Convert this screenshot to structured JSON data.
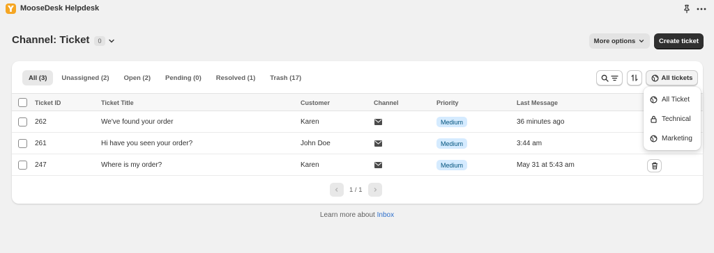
{
  "app": {
    "title": "MooseDesk Helpdesk"
  },
  "header": {
    "title": "Channel: Ticket",
    "count": "0",
    "more_options": "More options",
    "create_ticket": "Create ticket"
  },
  "tabs": [
    {
      "label": "All (3)",
      "active": true
    },
    {
      "label": "Unassigned (2)",
      "active": false
    },
    {
      "label": "Open (2)",
      "active": false
    },
    {
      "label": "Pending (0)",
      "active": false
    },
    {
      "label": "Resolved (1)",
      "active": false
    },
    {
      "label": "Trash (17)",
      "active": false
    }
  ],
  "toolbar": {
    "all_tickets": "All tickets"
  },
  "table": {
    "columns": [
      "Ticket ID",
      "Ticket Title",
      "Customer",
      "Channel",
      "Priority",
      "Last Message"
    ],
    "rows": [
      {
        "id": "262",
        "title": "We've found your order",
        "customer": "Karen",
        "channel": "mail-icon",
        "priority": "Medium",
        "last_message": "36 minutes ago"
      },
      {
        "id": "261",
        "title": "Hi have you seen your order?",
        "customer": "John Doe",
        "channel": "mail-icon",
        "priority": "Medium",
        "last_message": "3:44 am"
      },
      {
        "id": "247",
        "title": "Where is my order?",
        "customer": "Karen",
        "channel": "mail-icon",
        "priority": "Medium",
        "last_message": "May 31 at 5:43 am"
      }
    ]
  },
  "pagination": {
    "text": "1 / 1"
  },
  "dropdown": {
    "items": [
      {
        "label": "All Ticket",
        "icon": "globe-icon"
      },
      {
        "label": "Technical",
        "icon": "lock-icon"
      },
      {
        "label": "Marketing",
        "icon": "globe-icon"
      }
    ]
  },
  "footer": {
    "text": "Learn more about",
    "link": "Inbox"
  },
  "colors": {
    "accent": "#2c6ecb",
    "primary_button": "#303030",
    "badge_bg": "#d5ebff",
    "logo": "#f5a623"
  }
}
